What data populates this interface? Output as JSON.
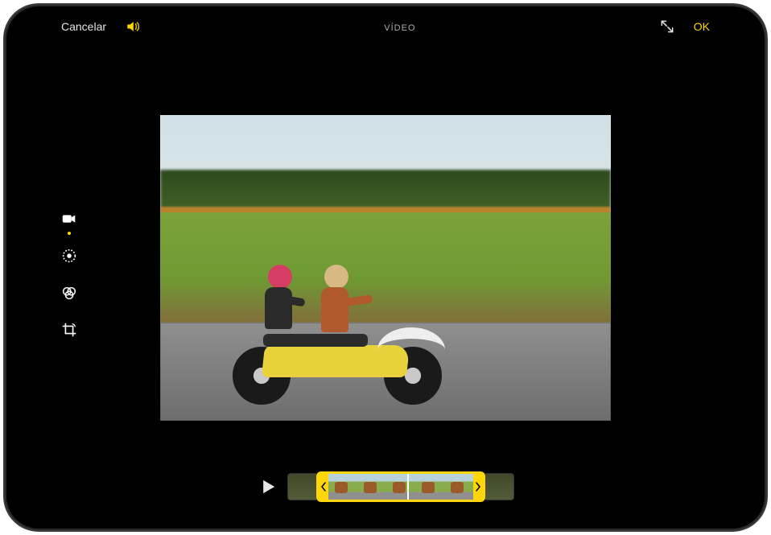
{
  "header": {
    "cancel_label": "Cancelar",
    "title": "VÍDEO",
    "done_label": "OK"
  },
  "accent_color": "#ffd60a",
  "tools": {
    "video": "video-icon",
    "adjust": "adjust-icon",
    "filters": "filters-icon",
    "crop": "crop-icon",
    "active": "video"
  },
  "timeline": {
    "thumbnail_count_inside": 5,
    "thumbnail_count_outside_left": 1,
    "thumbnail_count_outside_right": 1
  }
}
